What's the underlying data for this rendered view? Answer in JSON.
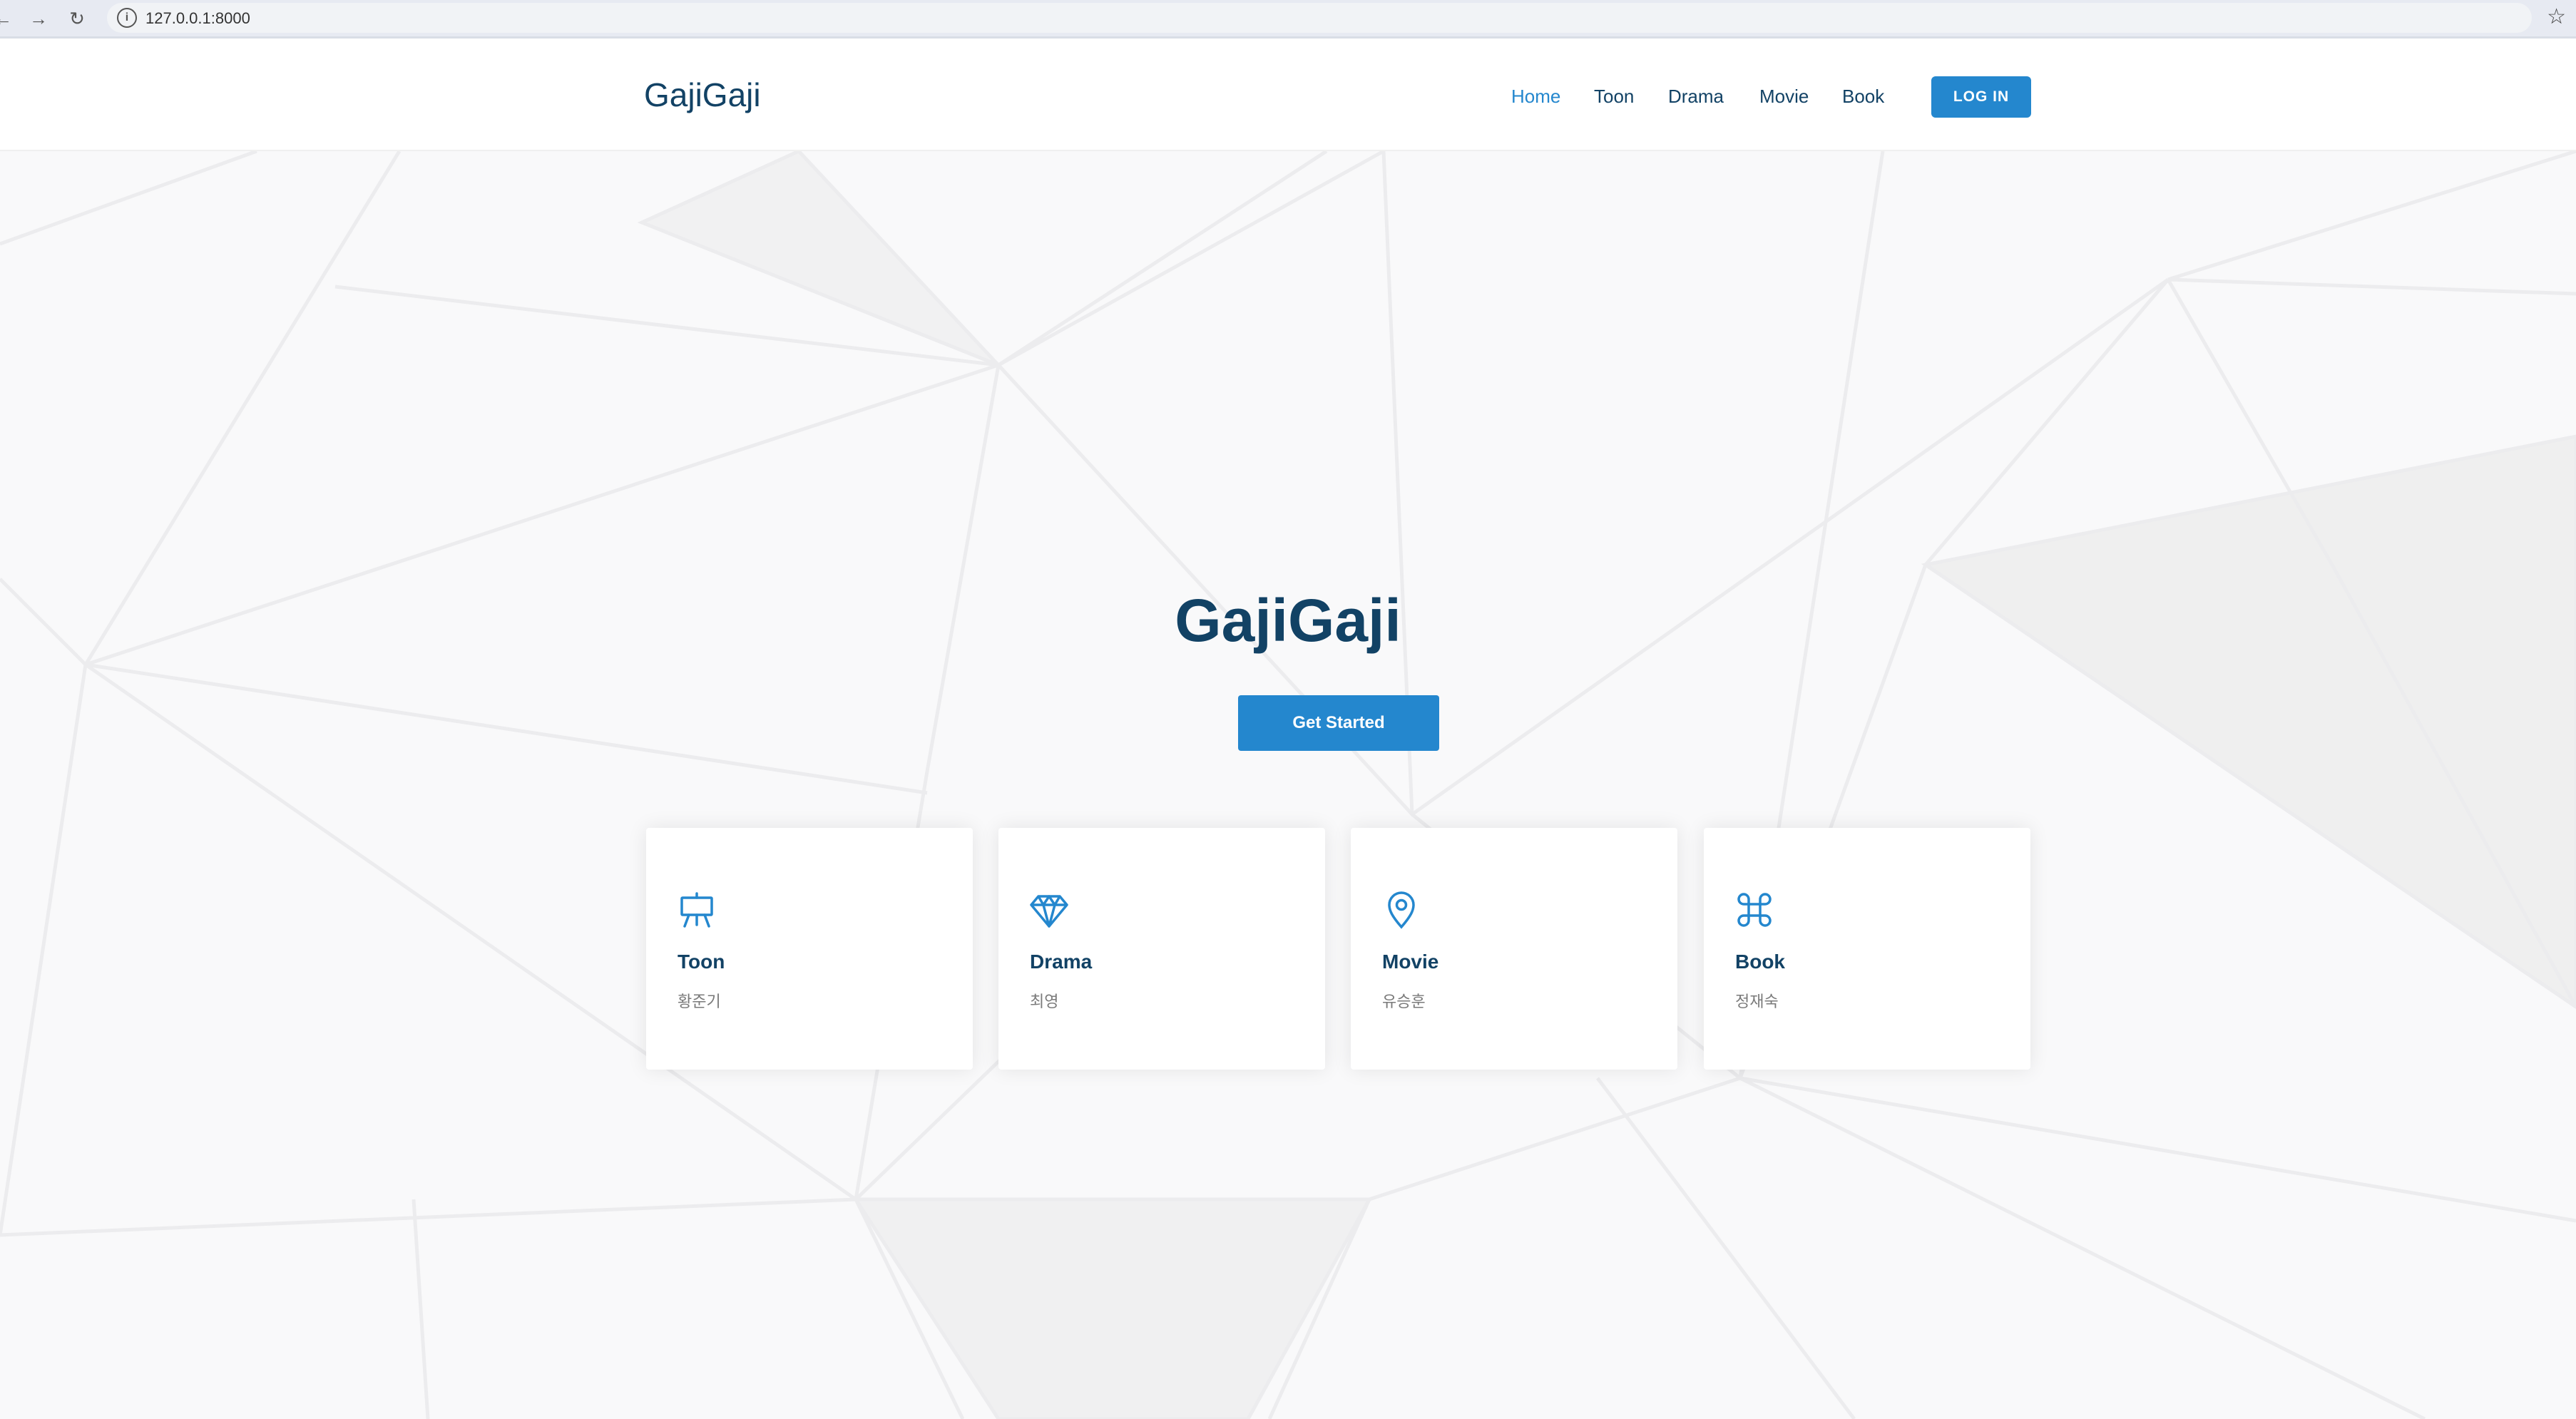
{
  "browser": {
    "url": "127.0.0.1:8000",
    "back_icon": "arrow-left-icon",
    "forward_icon": "arrow-right-icon",
    "reload_icon": "reload-icon",
    "info_icon": "info-icon",
    "star_icon": "star-icon"
  },
  "header": {
    "logo": "GajiGaji",
    "nav": [
      "Home",
      "Toon",
      "Drama",
      "Movie",
      "Book"
    ],
    "active": "Home",
    "login": "LOG IN"
  },
  "hero": {
    "title": "GajiGaji",
    "cta": "Get Started"
  },
  "cards": [
    {
      "icon": "easel-icon",
      "title": "Toon",
      "subtitle": "황준기"
    },
    {
      "icon": "diamond-icon",
      "title": "Drama",
      "subtitle": "최영"
    },
    {
      "icon": "map-pin-icon",
      "title": "Movie",
      "subtitle": "유승훈"
    },
    {
      "icon": "command-icon",
      "title": "Book",
      "subtitle": "정재숙"
    }
  ],
  "colors": {
    "primary": "#2487ce",
    "heading": "#124265",
    "muted": "#7a7a7a"
  }
}
